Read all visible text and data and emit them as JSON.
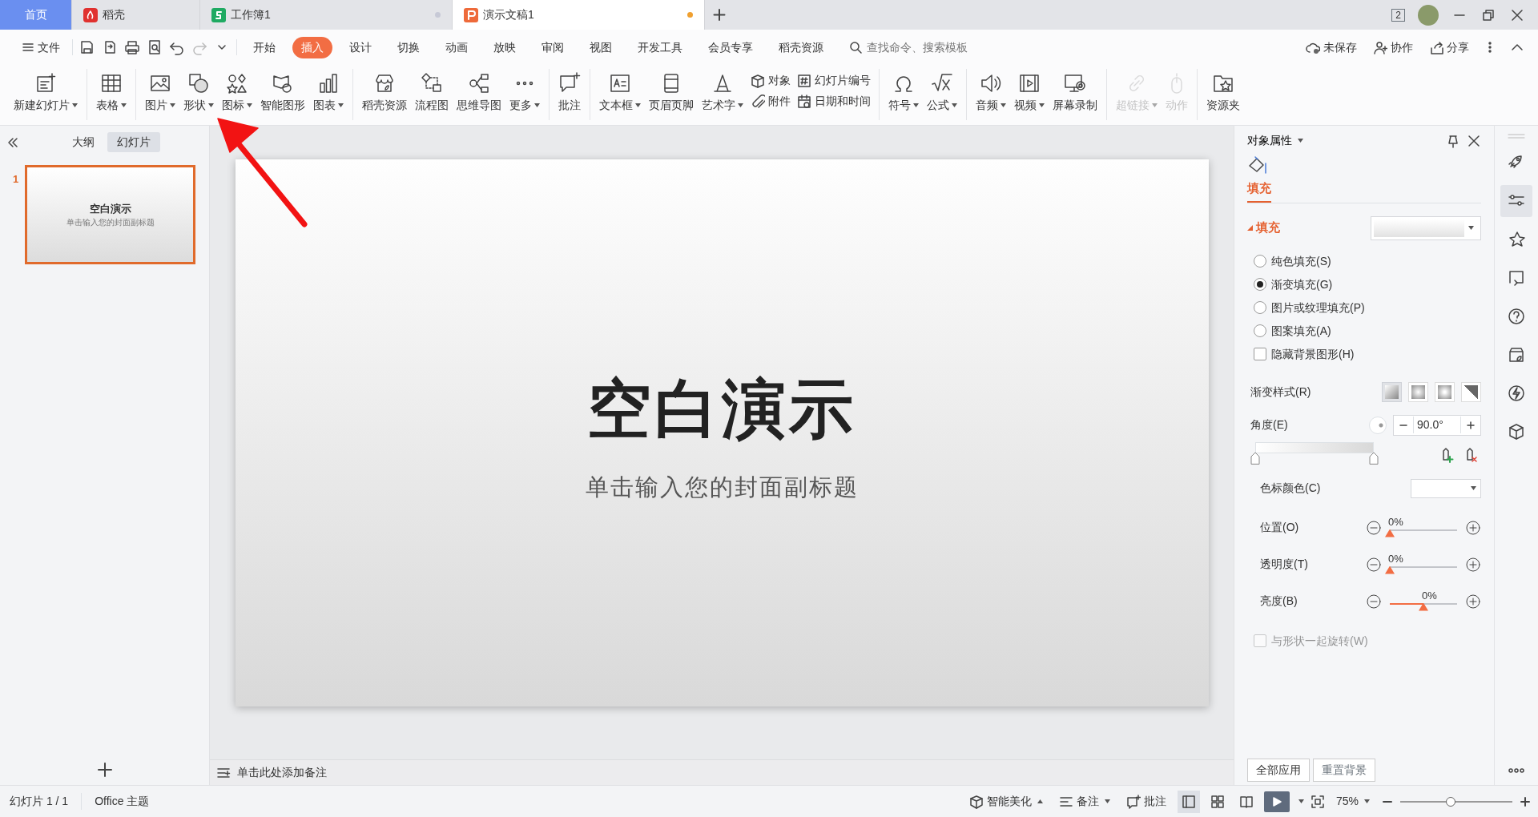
{
  "tabs": [
    {
      "label": "首页",
      "kind": "home",
      "selected": false
    },
    {
      "label": "稻壳",
      "kind": "docer",
      "selected": false
    },
    {
      "label": "工作簿1",
      "kind": "sheet",
      "selected": false,
      "color": "#c7c9d6"
    },
    {
      "label": "演示文稿1",
      "kind": "slides",
      "selected": true,
      "color": "#f0a030"
    }
  ],
  "window_count": "2",
  "menu": {
    "file": "文件",
    "tabs": [
      {
        "label": "开始",
        "selected": false
      },
      {
        "label": "插入",
        "selected": true
      },
      {
        "label": "设计",
        "selected": false
      },
      {
        "label": "切换",
        "selected": false
      },
      {
        "label": "动画",
        "selected": false
      },
      {
        "label": "放映",
        "selected": false
      },
      {
        "label": "审阅",
        "selected": false
      },
      {
        "label": "视图",
        "selected": false
      },
      {
        "label": "开发工具",
        "selected": false
      },
      {
        "label": "会员专享",
        "selected": false
      },
      {
        "label": "稻壳资源",
        "selected": false
      }
    ],
    "search": {
      "placeholder": "查找命令、搜索模板"
    },
    "actions": [
      "未保存",
      "协作",
      "分享"
    ]
  },
  "ribbon": [
    [
      {
        "kind": "large",
        "label": "新建幻灯片",
        "dropdown": true,
        "disabled": false
      }
    ],
    [
      {
        "kind": "large",
        "label": "表格",
        "dropdown": true,
        "disabled": false
      }
    ],
    [
      {
        "kind": "large",
        "label": "图片",
        "dropdown": true,
        "disabled": false
      },
      {
        "kind": "large",
        "label": "形状",
        "dropdown": true,
        "disabled": false
      },
      {
        "kind": "large",
        "label": "图标",
        "dropdown": true,
        "disabled": false
      },
      {
        "kind": "large",
        "label": "智能图形",
        "dropdown": false,
        "disabled": false
      },
      {
        "kind": "large",
        "label": "图表",
        "dropdown": true,
        "disabled": false
      }
    ],
    [
      {
        "kind": "large",
        "label": "稻壳资源",
        "dropdown": false,
        "disabled": false
      },
      {
        "kind": "large",
        "label": "流程图",
        "dropdown": false,
        "disabled": false
      },
      {
        "kind": "large",
        "label": "思维导图",
        "dropdown": false,
        "disabled": false
      },
      {
        "kind": "large",
        "label": "更多",
        "dropdown": true,
        "disabled": false
      }
    ],
    [
      {
        "kind": "large",
        "label": "批注",
        "dropdown": false,
        "disabled": false
      }
    ],
    [
      {
        "kind": "large",
        "label": "文本框",
        "dropdown": true,
        "disabled": false
      },
      {
        "kind": "large",
        "label": "页眉页脚",
        "dropdown": false,
        "disabled": false
      },
      {
        "kind": "large",
        "label": "艺术字",
        "dropdown": true,
        "disabled": false
      },
      {
        "kind": "stack",
        "items": [
          {
            "label": "对象",
            "dropdown": false,
            "disabled": false
          },
          {
            "label": "附件",
            "dropdown": false,
            "disabled": false
          }
        ]
      },
      {
        "kind": "stack",
        "items": [
          {
            "label": "幻灯片编号",
            "dropdown": false,
            "disabled": false
          },
          {
            "label": "日期和时间",
            "dropdown": false,
            "disabled": false
          }
        ]
      }
    ],
    [
      {
        "kind": "large",
        "label": "符号",
        "dropdown": true,
        "disabled": false
      },
      {
        "kind": "large",
        "label": "公式",
        "dropdown": true,
        "disabled": false
      }
    ],
    [
      {
        "kind": "large",
        "label": "音频",
        "dropdown": true,
        "disabled": false
      },
      {
        "kind": "large",
        "label": "视频",
        "dropdown": true,
        "disabled": false
      },
      {
        "kind": "large",
        "label": "屏幕录制",
        "dropdown": false,
        "disabled": false
      }
    ],
    [
      {
        "kind": "large",
        "label": "超链接",
        "dropdown": true,
        "disabled": true
      },
      {
        "kind": "large",
        "label": "动作",
        "dropdown": false,
        "disabled": true
      }
    ],
    [
      {
        "kind": "large",
        "label": "资源夹",
        "dropdown": false,
        "disabled": false
      }
    ]
  ],
  "left_pane": {
    "tabs": [
      {
        "label": "大纲",
        "selected": false
      },
      {
        "label": "幻灯片",
        "selected": true
      }
    ],
    "slides": [
      {
        "number": "1",
        "title": "空白演示",
        "subtitle": "单击输入您的封面副标题",
        "selected": true
      }
    ]
  },
  "slide": {
    "title": "空白演示",
    "subtitle": "单击输入您的封面副标题"
  },
  "notes": {
    "placeholder": "单击此处添加备注"
  },
  "annotations": [
    {
      "kind": "arrow"
    }
  ],
  "panel": {
    "title": "对象属性",
    "tab": {
      "label": "填充",
      "selected": true
    },
    "section": {
      "label": "填充",
      "expanded": true
    },
    "options": [
      {
        "kind": "radio",
        "label": "纯色填充(S)",
        "checked": false
      },
      {
        "kind": "radio",
        "label": "渐变填充(G)",
        "checked": true
      },
      {
        "kind": "radio",
        "label": "图片或纹理填充(P)",
        "checked": false
      },
      {
        "kind": "radio",
        "label": "图案填充(A)",
        "checked": false
      },
      {
        "kind": "checkbox",
        "label": "隐藏背景图形(H)",
        "checked": false
      }
    ],
    "gradient_style": {
      "label": "渐变样式(R)",
      "styles": [
        {
          "selected": true
        },
        {
          "selected": false
        },
        {
          "selected": false
        },
        {
          "selected": false
        }
      ]
    },
    "angle": {
      "label": "角度(E)",
      "value": "90.0°"
    },
    "stops": [
      {
        "level": 0
      },
      {
        "level": 1
      }
    ],
    "stop_color": {
      "label": "色标颜色(C)"
    },
    "sliders": [
      {
        "label": "位置(O)",
        "reading": "0%",
        "level": 0
      },
      {
        "label": "透明度(T)",
        "reading": "0%",
        "level": 0
      },
      {
        "label": "亮度(B)",
        "reading": "0%",
        "level": 0.5
      }
    ],
    "rotate": {
      "label": "与形状一起旋转(W)",
      "checked": false,
      "disabled": true
    },
    "buttons": [
      {
        "label": "全部应用",
        "disabled": false
      },
      {
        "label": "重置背景",
        "disabled": true
      }
    ]
  },
  "sidebar": [
    {
      "selected": false
    },
    {
      "selected": true
    },
    {
      "selected": false
    },
    {
      "selected": false
    },
    {
      "selected": false
    },
    {
      "selected": false
    },
    {
      "selected": false
    },
    {
      "selected": false
    }
  ],
  "status": {
    "slide": "幻灯片 1 / 1",
    "theme": "Office 主题",
    "beautify": "智能美化",
    "notes": "备注",
    "comments": "批注",
    "views": [
      {
        "selected": true
      },
      {
        "selected": false
      },
      {
        "selected": false
      }
    ],
    "zoom": "75%",
    "zoom_level": {
      "level": 0.45
    }
  }
}
